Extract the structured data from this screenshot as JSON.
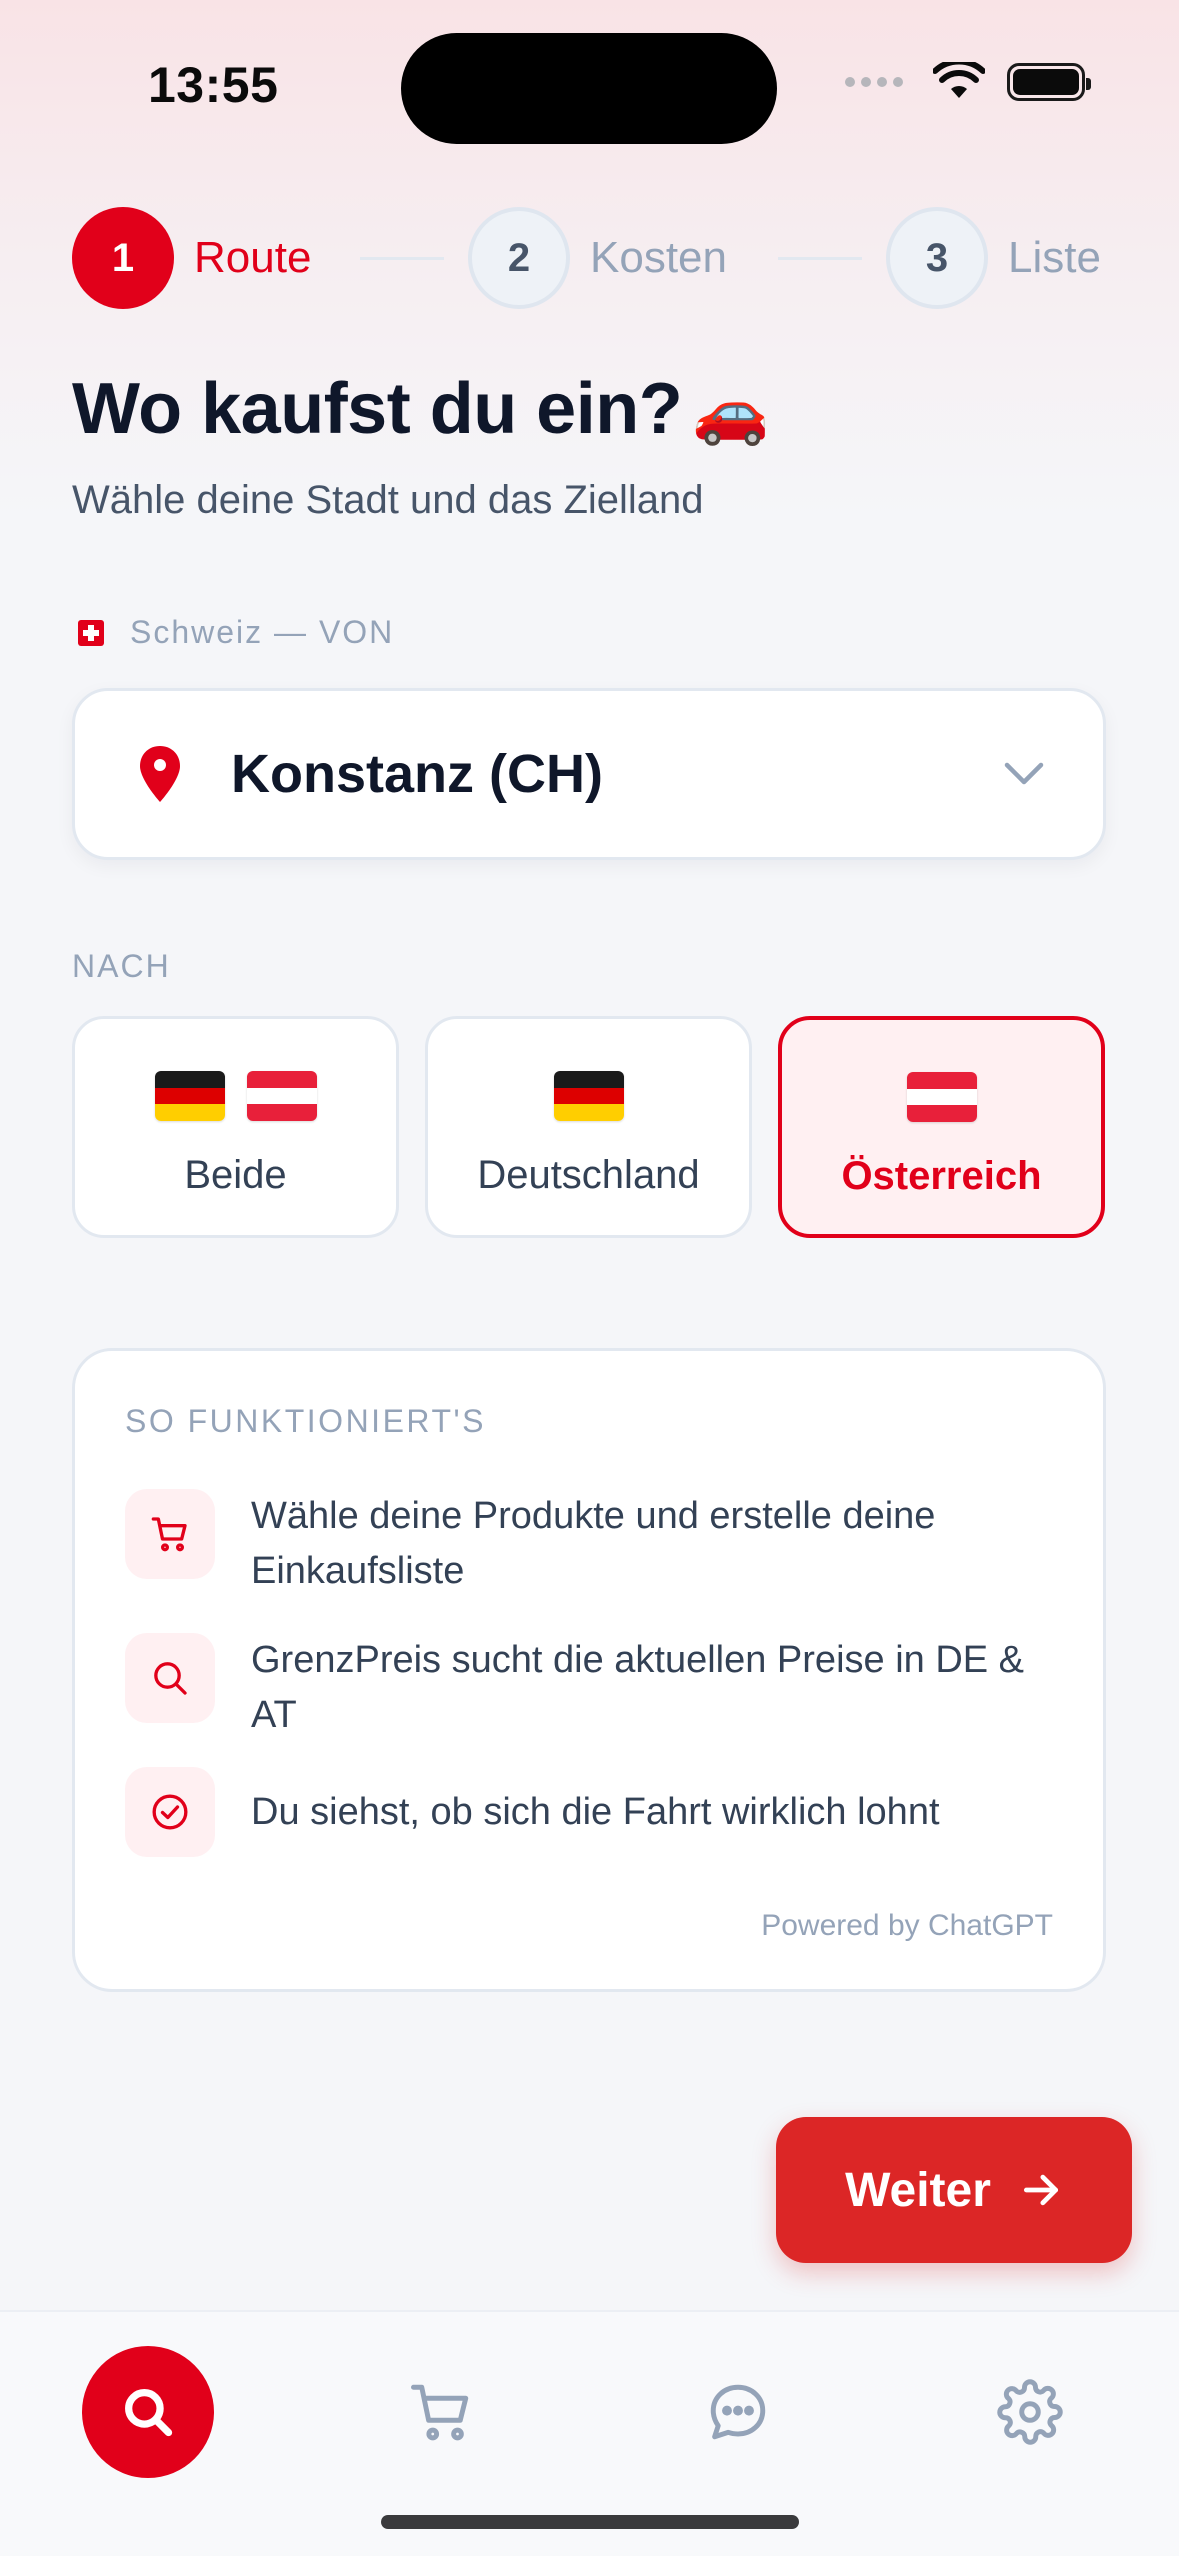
{
  "status_bar": {
    "time": "13:55"
  },
  "stepper": {
    "steps": [
      {
        "number": "1",
        "label": "Route",
        "state": "active"
      },
      {
        "number": "2",
        "label": "Kosten",
        "state": "inactive"
      },
      {
        "number": "3",
        "label": "Liste",
        "state": "inactive"
      }
    ]
  },
  "header": {
    "title": "Wo kaufst du ein?",
    "title_emoji": "🚗",
    "subtitle": "Wähle deine Stadt und das Zielland"
  },
  "from": {
    "label": "Schweiz — VON",
    "flag_icon": "swiss-flag-icon",
    "selected_city": "Konstanz (CH)"
  },
  "to": {
    "label": "NACH",
    "options": [
      {
        "label": "Beide",
        "flags": [
          "de",
          "at"
        ],
        "selected": false
      },
      {
        "label": "Deutschland",
        "flags": [
          "de"
        ],
        "selected": false
      },
      {
        "label": "Österreich",
        "flags": [
          "at"
        ],
        "selected": true
      }
    ]
  },
  "how_it_works": {
    "title": "SO FUNKTIONIERT'S",
    "items": [
      {
        "icon": "cart-icon",
        "text": "Wähle deine Produkte und erstelle deine Einkaufsliste"
      },
      {
        "icon": "search-icon",
        "text": "GrenzPreis sucht die aktuellen Preise in DE & AT"
      },
      {
        "icon": "check-circle-icon",
        "text": "Du siehst, ob sich die Fahrt wirklich lohnt"
      }
    ],
    "powered_by": "Powered by ChatGPT"
  },
  "actions": {
    "next_label": "Weiter"
  },
  "tab_bar": {
    "items": [
      {
        "icon": "search-icon",
        "active": true
      },
      {
        "icon": "cart-icon",
        "active": false
      },
      {
        "icon": "chat-icon",
        "active": false
      },
      {
        "icon": "gear-icon",
        "active": false
      }
    ]
  },
  "colors": {
    "accent": "#e1001a",
    "button": "#dc2626",
    "text_primary": "#0f172a",
    "text_secondary": "#475569",
    "muted": "#94a3b8"
  }
}
